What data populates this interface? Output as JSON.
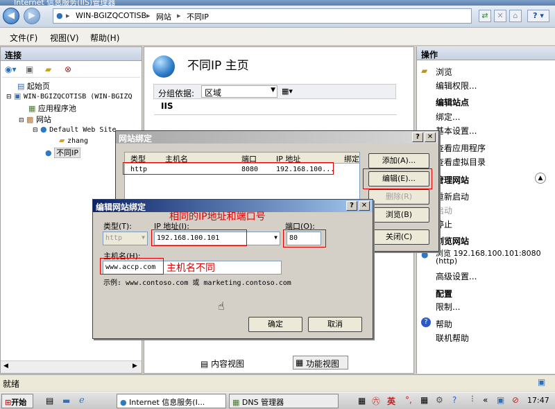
{
  "window": {
    "title": "Internet 信息服务(IIS)管理器"
  },
  "navbar": {
    "breadcrumb": [
      "WIN-BGIZQCOTISB",
      "网站",
      "不同IP"
    ],
    "separator": "▸",
    "help_label": "?"
  },
  "menu": {
    "items": [
      "文件(F)",
      "视图(V)",
      "帮助(H)"
    ]
  },
  "left": {
    "header": "连接",
    "tree": [
      {
        "label": "起始页"
      },
      {
        "label": "WIN-BGIZQCOTISB (WIN-BGIZQ"
      },
      {
        "label": "应用程序池"
      },
      {
        "label": "网站"
      },
      {
        "label": "Default Web Site"
      },
      {
        "label": "zhang"
      },
      {
        "label": "不同IP"
      }
    ]
  },
  "center": {
    "title": "不同IP 主页",
    "group_label": "分组依据:",
    "group_value": "区域",
    "section": "IIS",
    "bottom_tabs": [
      "功能视图",
      "内容视图"
    ]
  },
  "right": {
    "header": "操作",
    "items": {
      "browse": "浏览",
      "edit_perm": "编辑权限...",
      "edit_site": "编辑站点",
      "bind": "绑定...",
      "basic": "基本设置...",
      "view_apps": "查看应用程序",
      "view_vdirs": "查看虚拟目录",
      "manage_site": "管理网站",
      "restart": "重新启动",
      "start": "启动",
      "stop": "停止",
      "browse_site": "浏览网站",
      "browse_addr": "浏览 192.168.100.101:8080",
      "browse_proto": "(http)",
      "advanced": "高级设置...",
      "config": "配置",
      "limits": "限制...",
      "help": "帮助",
      "online_help": "联机帮助"
    }
  },
  "site_bindings": {
    "title": "网站绑定",
    "columns": [
      "类型",
      "主机名",
      "端口",
      "IP 地址",
      "绑定"
    ],
    "row": {
      "type": "http",
      "host": "",
      "port": "8080",
      "ip": "192.168.100..."
    },
    "buttons": {
      "add": "添加(A)...",
      "edit": "编辑(E)...",
      "remove": "删除(R)",
      "browse": "浏览(B)",
      "close": "关闭(C)"
    }
  },
  "edit_binding": {
    "title": "编辑网站绑定",
    "type_label": "类型(T):",
    "type_value": "http",
    "ip_label": "IP 地址(I):",
    "ip_value": "192.168.100.101",
    "port_label": "端口(O):",
    "port_value": "80",
    "host_label": "主机名(H):",
    "host_value": "www.accp.com",
    "example": "示例: www.contoso.com 或 marketing.contoso.com",
    "ok": "确定",
    "cancel": "取消"
  },
  "annotations": {
    "same_ip_port": "相同的IP地址和端口号",
    "diff_host": "主机名不同"
  },
  "status": {
    "text": "就绪"
  },
  "taskbar": {
    "start": "开始",
    "tasks": [
      "Internet 信息服务(I...",
      "DNS 管理器"
    ],
    "ime": "英",
    "clock": "17:47"
  },
  "colors": {
    "annotation": "#e00000",
    "title_active": "#0a246a"
  }
}
